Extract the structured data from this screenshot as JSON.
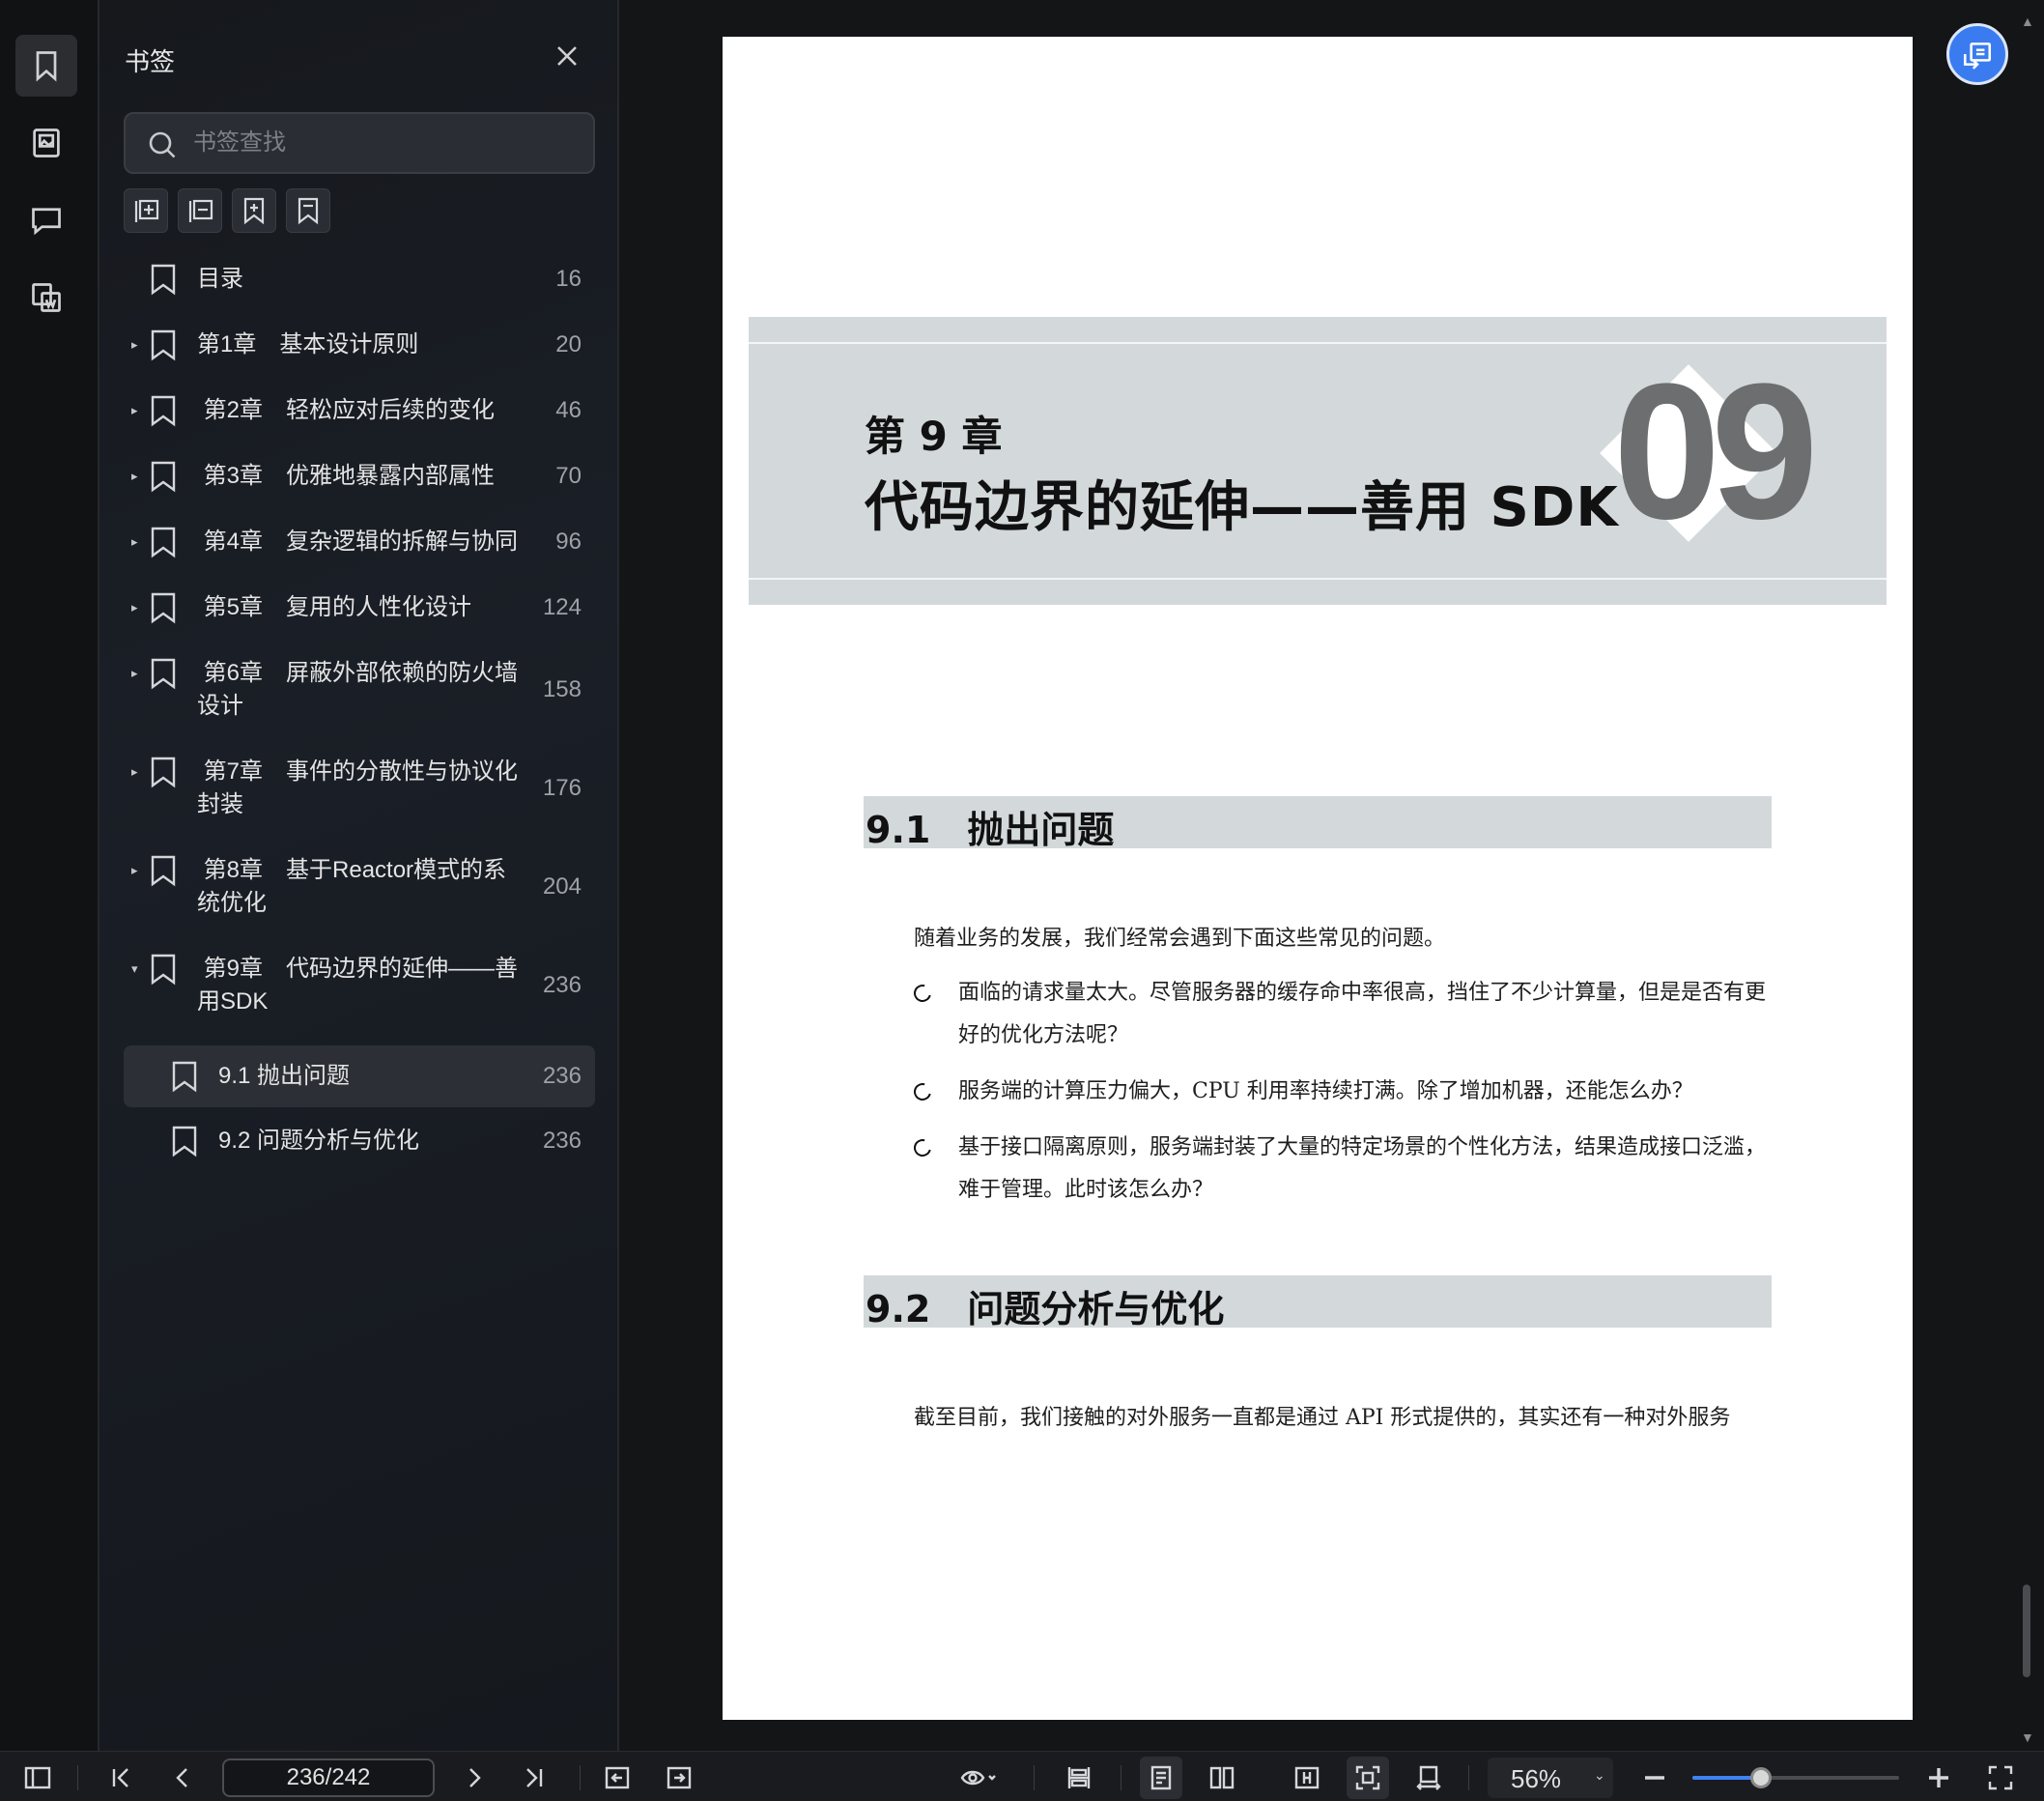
{
  "panel": {
    "title": "书签",
    "search_placeholder": "书签查找",
    "bookmarks": [
      {
        "label": "目录",
        "page": "16",
        "arrow": ""
      },
      {
        "label": "第1章　基本设计原则",
        "page": "20",
        "arrow": "▸"
      },
      {
        "label": " 第2章　轻松应对后续的变化",
        "page": "46",
        "arrow": "▸"
      },
      {
        "label": " 第3章　优雅地暴露内部属性",
        "page": "70",
        "arrow": "▸"
      },
      {
        "label": " 第4章　复杂逻辑的拆解与协同",
        "page": "96",
        "arrow": "▸"
      },
      {
        "label": " 第5章　复用的人性化设计",
        "page": "124",
        "arrow": "▸"
      },
      {
        "label": " 第6章　屏蔽外部依赖的防火墙\n设计",
        "page": "158",
        "arrow": "▸"
      },
      {
        "label": " 第7章　事件的分散性与协议化\n封装",
        "page": "176",
        "arrow": "▸"
      },
      {
        "label": " 第8章　基于Reactor模式的系\n统优化",
        "page": "204",
        "arrow": "▸"
      },
      {
        "label": " 第9章　代码边界的延伸——善\n用SDK",
        "page": "236",
        "arrow": "▾"
      },
      {
        "label": "9.1 抛出问题",
        "page": "236",
        "arrow": ""
      },
      {
        "label": "9.2 问题分析与优化",
        "page": "236",
        "arrow": ""
      }
    ]
  },
  "page": {
    "chapter_label": "第 9 章",
    "chapter_title": "代码边界的延伸——善用 SDK",
    "chapter_number": "09",
    "sec1_title": "9.1　抛出问题",
    "sec1_intro": "随着业务的发展，我们经常会遇到下面这些常见的问题。",
    "bullets": [
      "面临的请求量太大。尽管服务器的缓存命中率很高，挡住了不少计算量，但是是否有更好的优化方法呢？",
      "服务端的计算压力偏大，CPU 利用率持续打满。除了增加机器，还能怎么办？",
      "基于接口隔离原则，服务端封装了大量的特定场景的个性化方法，结果造成接口泛滥，难于管理。此时该怎么办？"
    ],
    "sec2_title": "9.2　问题分析与优化",
    "sec2_text": "截至目前，我们接触的对外服务一直都是通过 API 形式提供的，其实还有一种对外服务"
  },
  "toolbar": {
    "page_indicator": "236/242",
    "zoom": "56%",
    "zoom_fraction": 0.33
  }
}
